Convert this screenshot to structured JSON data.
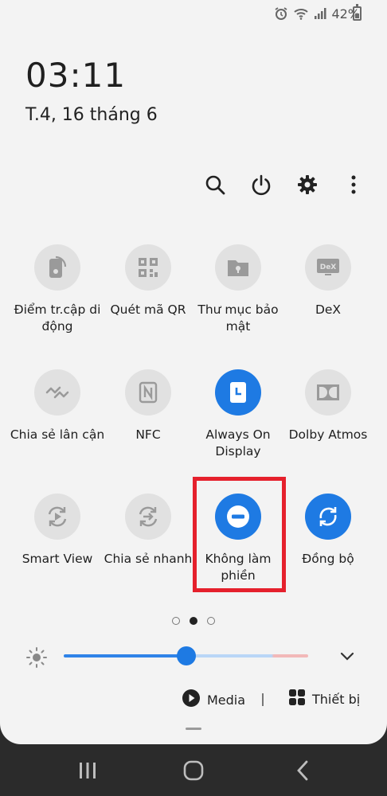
{
  "status_bar": {
    "battery_text": "42%",
    "battery_level": 0.42,
    "icons": [
      "alarm-icon",
      "wifi-icon",
      "signal-icon",
      "battery-icon"
    ]
  },
  "clock": {
    "time": "03:11",
    "date": "T.4, 16 tháng 6"
  },
  "toolbar": {
    "icons": [
      "search-icon",
      "power-icon",
      "gear-icon",
      "more-vert-icon"
    ]
  },
  "tiles": [
    {
      "label": "Điểm tr.cập di động",
      "icon": "hotspot-icon",
      "active": false
    },
    {
      "label": "Quét mã QR",
      "icon": "qr-code-icon",
      "active": false
    },
    {
      "label": "Thư mục bảo mật",
      "icon": "secure-folder-icon",
      "active": false
    },
    {
      "label": "DeX",
      "icon": "dex-icon",
      "active": false
    },
    {
      "label": "Chia sẻ lân cận",
      "icon": "nearby-share-icon",
      "active": false
    },
    {
      "label": "NFC",
      "icon": "nfc-icon",
      "active": false
    },
    {
      "label": "Always On Display",
      "icon": "always-on-display-icon",
      "active": true
    },
    {
      "label": "Dolby Atmos",
      "icon": "dolby-icon",
      "active": false
    },
    {
      "label": "Smart View",
      "icon": "smart-view-icon",
      "active": false
    },
    {
      "label": "Chia sẻ nhanh",
      "icon": "quick-share-icon",
      "active": false
    },
    {
      "label": "Không làm phiền",
      "icon": "do-not-disturb-icon",
      "active": true
    },
    {
      "label": "Đồng bộ",
      "icon": "sync-icon",
      "active": true
    }
  ],
  "pagination": {
    "pages": 3,
    "current": 2
  },
  "brightness": {
    "level": 0.5
  },
  "media": {
    "media_label": "Media",
    "devices_label": "Thiết bị"
  },
  "colors": {
    "accent": "#1e7ae3",
    "highlight": "#e5202c",
    "panel": "#f3f3f3",
    "nav": "#2b2b2b"
  },
  "nav": {
    "icons": [
      "recents-icon",
      "home-icon",
      "back-icon"
    ]
  }
}
